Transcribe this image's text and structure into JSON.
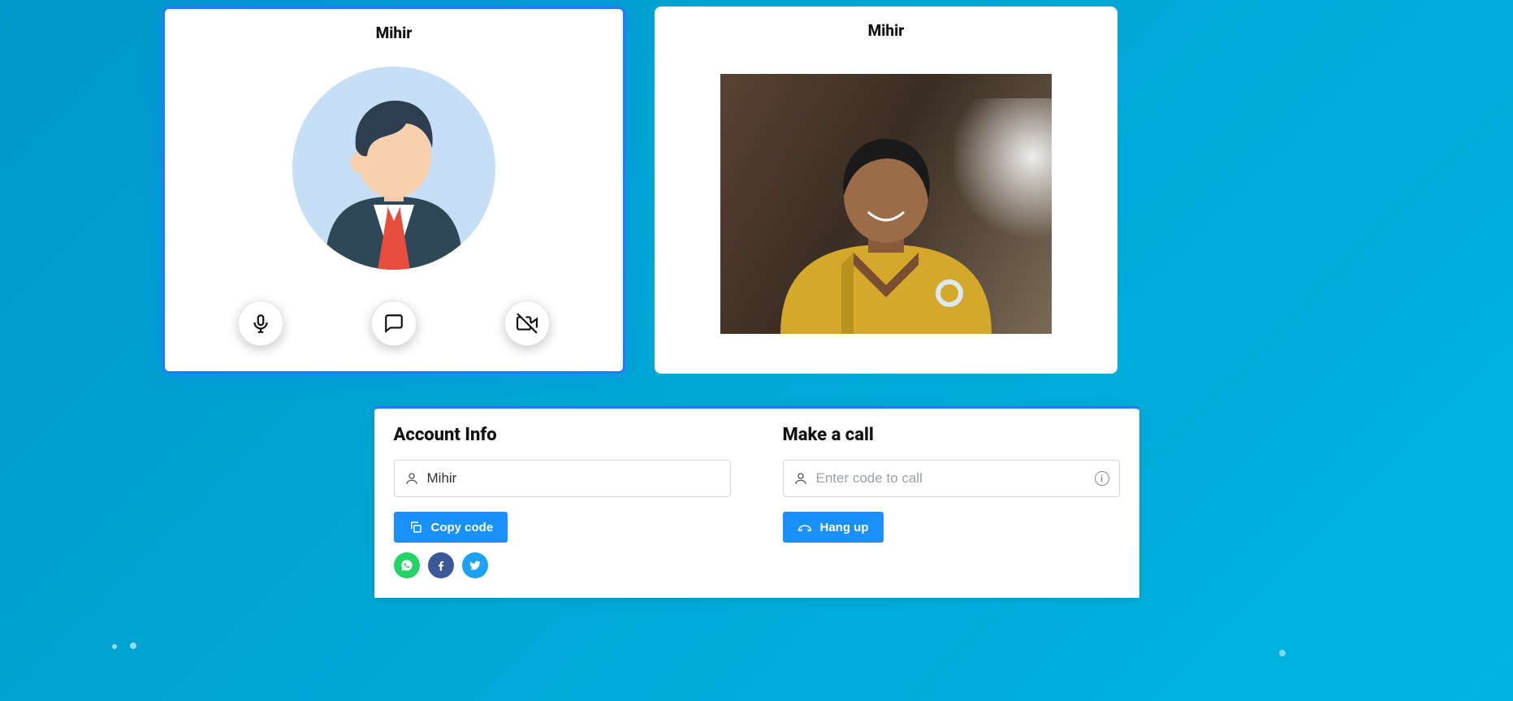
{
  "video_left": {
    "name": "Mihir",
    "active": true
  },
  "video_right": {
    "name": "Mihir"
  },
  "controls": {
    "mic": "microphone",
    "chat": "chat",
    "camera": "camera-off"
  },
  "account_info": {
    "title": "Account Info",
    "name_value": "Mihir",
    "copy_label": "Copy code"
  },
  "make_call": {
    "title": "Make a call",
    "placeholder": "Enter code to call",
    "value": "",
    "hangup_label": "Hang up"
  },
  "share": {
    "whatsapp": "whatsapp",
    "facebook": "facebook",
    "twitter": "twitter"
  }
}
